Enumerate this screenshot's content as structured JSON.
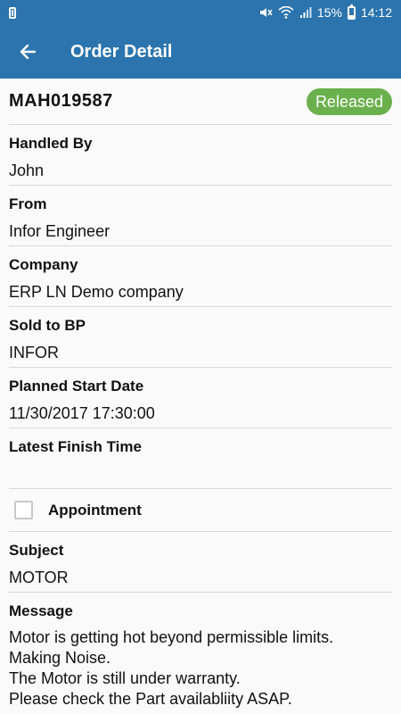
{
  "status_bar": {
    "battery_percent": "15%",
    "time": "14:12"
  },
  "toolbar": {
    "title": "Order Detail"
  },
  "order": {
    "id": "MAH019587",
    "status": "Released",
    "status_color": "#6ab04c"
  },
  "fields": [
    {
      "label": "Handled By",
      "value": "John"
    },
    {
      "label": "From",
      "value": "Infor Engineer"
    },
    {
      "label": "Company",
      "value": "ERP LN Demo company"
    },
    {
      "label": "Sold to BP",
      "value": "INFOR"
    },
    {
      "label": "Planned Start Date",
      "value": "11/30/2017  17:30:00"
    },
    {
      "label": "Latest Finish Time",
      "value": ""
    }
  ],
  "appointment": {
    "label": "Appointment",
    "checked": false
  },
  "subject": {
    "label": "Subject",
    "value": "MOTOR"
  },
  "message": {
    "label": "Message",
    "value": "Motor is getting hot beyond permissible limits.\nMaking Noise.\nThe Motor is still under warranty.\nPlease check the Part availabliity ASAP."
  },
  "colors": {
    "primary": "#2b74ad",
    "background": "#fafafa",
    "divider": "#d8d8d8"
  }
}
